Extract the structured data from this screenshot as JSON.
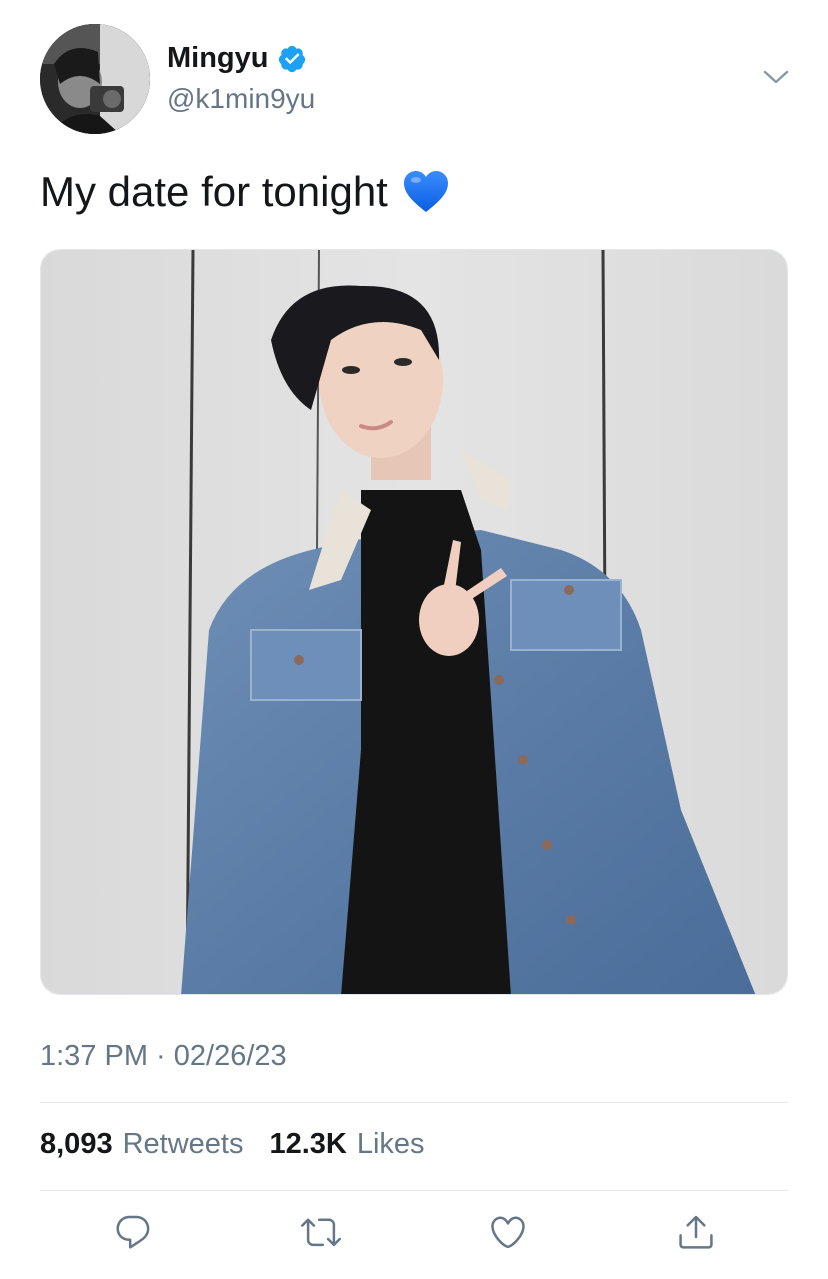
{
  "user": {
    "display_name": "Mingyu",
    "handle": "@k1min9yu",
    "verified": true,
    "verified_color": "#1da1f2"
  },
  "tweet": {
    "text": "My date for tonight",
    "emoji": "blue-heart-icon",
    "timestamp": "1:37 PM · 02/26/23"
  },
  "stats": {
    "retweets_count": "8,093",
    "retweets_label": "Retweets",
    "likes_count": "12.3K",
    "likes_label": "Likes"
  },
  "actions": {
    "reply": "reply-icon",
    "retweet": "retweet-icon",
    "like": "like-icon",
    "share": "share-icon"
  },
  "colors": {
    "text_primary": "#14171a",
    "text_secondary": "#657786",
    "icon": "#657786",
    "divider": "#e1e8ed",
    "accent": "#1da1f2"
  }
}
